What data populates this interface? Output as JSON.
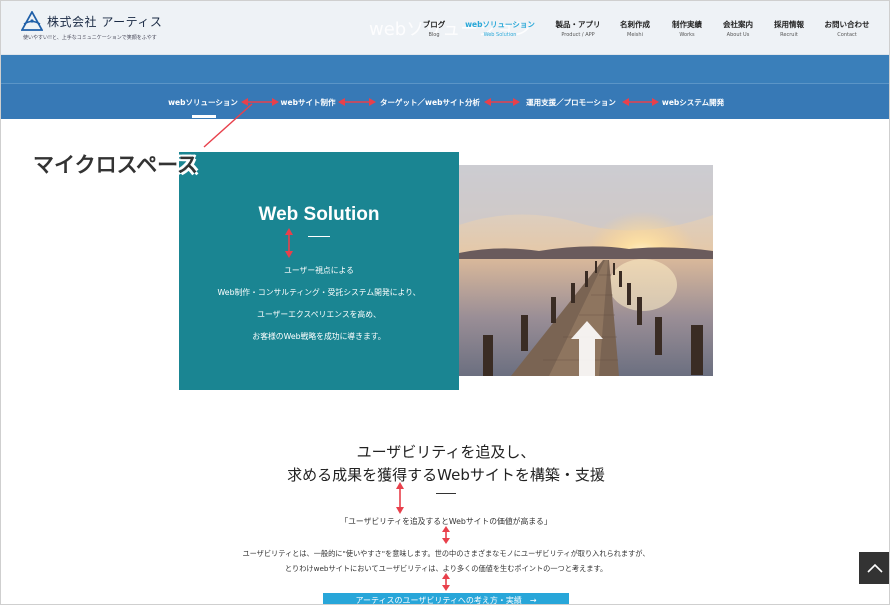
{
  "header": {
    "logo": {
      "company_name": "株式会社 アーティス",
      "tagline": "使いやすい!!と、上手なコミュニケーションで笑顔をふやす"
    },
    "watermark_title": "webソリューション",
    "global_nav": [
      {
        "ja": "ブログ",
        "en": "Blog",
        "active": false
      },
      {
        "ja": "webソリューション",
        "en": "Web Solution",
        "active": true
      },
      {
        "ja": "製品・アプリ",
        "en": "Product / APP",
        "active": false
      },
      {
        "ja": "名刺作成",
        "en": "Meishi",
        "active": false
      },
      {
        "ja": "制作実績",
        "en": "Works",
        "active": false
      },
      {
        "ja": "会社案内",
        "en": "About Us",
        "active": false
      },
      {
        "ja": "採用情報",
        "en": "Recruit",
        "active": false
      },
      {
        "ja": "お問い合わせ",
        "en": "Contact",
        "active": false
      }
    ]
  },
  "sub_nav": [
    {
      "label": "webソリューション",
      "active": true
    },
    {
      "label": "webサイト制作",
      "active": false
    },
    {
      "label": "ターゲット／webサイト分析",
      "active": false
    },
    {
      "label": "運用支援／プロモーション",
      "active": false
    },
    {
      "label": "webシステム開発",
      "active": false
    }
  ],
  "annotation": {
    "label": "マイクロスペース",
    "color": "#e8404b"
  },
  "hero": {
    "title": "Web Solution",
    "lines": [
      "ユーザー視点による",
      "Web制作・コンサルティング・受託システム開発により、",
      "ユーザーエクスペリエンスを高め、",
      "お客様のWeb戦略を成功に導きます。"
    ],
    "photo_icon": "pier-sunset-photo"
  },
  "main": {
    "heading_lines": [
      "ユーザビリティを追及し、",
      "求める成果を獲得するWebサイトを構築・支援"
    ],
    "quote": "「ユーザビリティを追及するとWebサイトの価値が高まる」",
    "body_lines": [
      "ユーザビリティとは、一般的に\"使いやすさ\"を意味します。世の中のさまざまなモノにユーザビリティが取り入れられますが、",
      "とりわけwebサイトにおいてユーザビリティは、より多くの価値を生むポイントの一つと考えます。"
    ],
    "cta_label": "アーティスのユーザビリティへの考え方・実績　→"
  },
  "page_top": {
    "icon": "chevron-up-icon"
  },
  "colors": {
    "header_bg": "#eef2f6",
    "nav_band": "#3779b6",
    "hero_box": "#1a8592",
    "active_nav": "#29a8d8",
    "cta": "#28a6d9",
    "annotation": "#e8404b"
  }
}
